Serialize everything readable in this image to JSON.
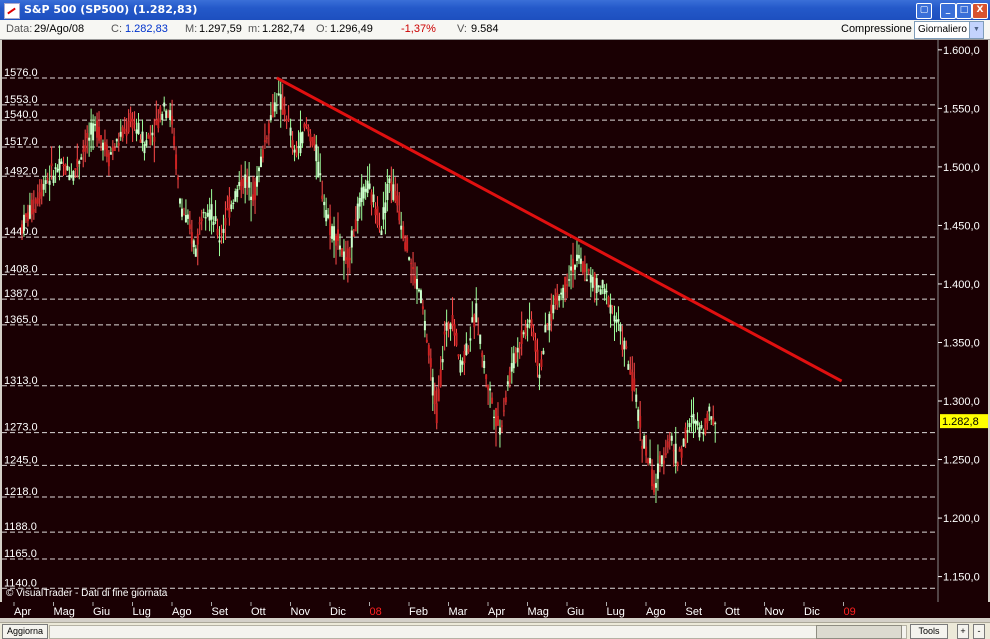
{
  "window": {
    "title": "S&P 500 (SP500) (1.282,83)",
    "min_label": "_",
    "max_label": "□",
    "close_label": "X",
    "restore_label": "▢"
  },
  "infobar": {
    "date_label": "Data:",
    "date_value": "29/Ago/08",
    "close_label": "C:",
    "close_value": "1.282,83",
    "max_label": "M:",
    "max_value": "1.297,59",
    "min_label": "m:",
    "min_value": "1.282,74",
    "open_label": "O:",
    "open_value": "1.296,49",
    "change_value": "-1,37%",
    "volume_label": "V:",
    "volume_value": "9.584",
    "compression_label": "Compressione",
    "compression_value": "Giornaliero"
  },
  "chart_data": {
    "type": "candlestick",
    "price_axis": [
      "1.600,0",
      "1.550,0",
      "1.500,0",
      "1.450,0",
      "1.400,0",
      "1.350,0",
      "1.300,0",
      "1.250,0",
      "1.200,0",
      "1.150,0"
    ],
    "ylim": [
      1130,
      1605
    ],
    "last_price_label": "1.282,8",
    "last_price": 1282.8,
    "support_levels": [
      {
        "label": "1576.0",
        "value": 1576
      },
      {
        "label": "1553.0",
        "value": 1553
      },
      {
        "label": "1540.0",
        "value": 1540
      },
      {
        "label": "1517.0",
        "value": 1517
      },
      {
        "label": "1492.0",
        "value": 1492
      },
      {
        "label": "1440.0",
        "value": 1440
      },
      {
        "label": "1408.0",
        "value": 1408
      },
      {
        "label": "1387.0",
        "value": 1387
      },
      {
        "label": "1365.0",
        "value": 1365
      },
      {
        "label": "1313.0",
        "value": 1313
      },
      {
        "label": "1273.0",
        "value": 1273
      },
      {
        "label": "1245.0",
        "value": 1245
      },
      {
        "label": "1218.0",
        "value": 1218
      },
      {
        "label": "1188.0",
        "value": 1188
      },
      {
        "label": "1165.0",
        "value": 1165
      },
      {
        "label": "1140.0",
        "value": 1140
      }
    ],
    "months": [
      {
        "label": "Apr",
        "red": false
      },
      {
        "label": "Mag",
        "red": false
      },
      {
        "label": "Giu",
        "red": false
      },
      {
        "label": "Lug",
        "red": false
      },
      {
        "label": "Ago",
        "red": false
      },
      {
        "label": "Set",
        "red": false
      },
      {
        "label": "Ott",
        "red": false
      },
      {
        "label": "Nov",
        "red": false
      },
      {
        "label": "Dic",
        "red": false
      },
      {
        "label": "08",
        "red": true
      },
      {
        "label": "Feb",
        "red": false
      },
      {
        "label": "Mar",
        "red": false
      },
      {
        "label": "Apr",
        "red": false
      },
      {
        "label": "Mag",
        "red": false
      },
      {
        "label": "Giu",
        "red": false
      },
      {
        "label": "Lug",
        "red": false
      },
      {
        "label": "Ago",
        "red": false
      },
      {
        "label": "Set",
        "red": false
      },
      {
        "label": "Ott",
        "red": false
      },
      {
        "label": "Nov",
        "red": false
      },
      {
        "label": "Dic",
        "red": false
      },
      {
        "label": "09",
        "red": true
      }
    ],
    "trendline": {
      "from": {
        "month": 6.45,
        "price": 1576
      },
      "to": {
        "month": 20.75,
        "price": 1317
      }
    },
    "price_path": [
      [
        0.0,
        1450
      ],
      [
        0.3,
        1468
      ],
      [
        0.6,
        1490
      ],
      [
        1.0,
        1500
      ],
      [
        1.3,
        1495
      ],
      [
        1.6,
        1520
      ],
      [
        1.9,
        1535
      ],
      [
        2.2,
        1510
      ],
      [
        2.5,
        1525
      ],
      [
        2.8,
        1540
      ],
      [
        3.1,
        1520
      ],
      [
        3.4,
        1535
      ],
      [
        3.6,
        1555
      ],
      [
        3.8,
        1540
      ],
      [
        4.0,
        1470
      ],
      [
        4.2,
        1450
      ],
      [
        4.4,
        1430
      ],
      [
        4.6,
        1470
      ],
      [
        4.8,
        1460
      ],
      [
        5.0,
        1440
      ],
      [
        5.3,
        1470
      ],
      [
        5.6,
        1490
      ],
      [
        5.9,
        1480
      ],
      [
        6.2,
        1530
      ],
      [
        6.45,
        1560
      ],
      [
        6.7,
        1545
      ],
      [
        6.9,
        1510
      ],
      [
        7.2,
        1535
      ],
      [
        7.4,
        1520
      ],
      [
        7.6,
        1480
      ],
      [
        7.8,
        1450
      ],
      [
        8.0,
        1440
      ],
      [
        8.2,
        1415
      ],
      [
        8.5,
        1460
      ],
      [
        8.7,
        1485
      ],
      [
        8.9,
        1470
      ],
      [
        9.1,
        1450
      ],
      [
        9.3,
        1490
      ],
      [
        9.5,
        1470
      ],
      [
        9.7,
        1440
      ],
      [
        9.9,
        1410
      ],
      [
        10.1,
        1390
      ],
      [
        10.3,
        1340
      ],
      [
        10.5,
        1290
      ],
      [
        10.7,
        1355
      ],
      [
        10.9,
        1375
      ],
      [
        11.1,
        1330
      ],
      [
        11.3,
        1350
      ],
      [
        11.5,
        1375
      ],
      [
        11.7,
        1330
      ],
      [
        11.9,
        1300
      ],
      [
        12.1,
        1275
      ],
      [
        12.3,
        1315
      ],
      [
        12.5,
        1340
      ],
      [
        12.7,
        1360
      ],
      [
        12.9,
        1370
      ],
      [
        13.1,
        1325
      ],
      [
        13.3,
        1365
      ],
      [
        13.5,
        1385
      ],
      [
        13.7,
        1395
      ],
      [
        13.9,
        1415
      ],
      [
        14.1,
        1420
      ],
      [
        14.3,
        1410
      ],
      [
        14.5,
        1400
      ],
      [
        14.7,
        1395
      ],
      [
        14.9,
        1385
      ],
      [
        15.1,
        1365
      ],
      [
        15.3,
        1340
      ],
      [
        15.5,
        1310
      ],
      [
        15.7,
        1270
      ],
      [
        15.9,
        1245
      ],
      [
        16.0,
        1225
      ],
      [
        16.2,
        1250
      ],
      [
        16.4,
        1270
      ],
      [
        16.6,
        1250
      ],
      [
        16.8,
        1270
      ],
      [
        17.0,
        1285
      ],
      [
        17.2,
        1275
      ],
      [
        17.4,
        1290
      ],
      [
        17.6,
        1282
      ]
    ]
  },
  "footer": {
    "credit": "VisualTrader - Dati di fine giornata",
    "update_button": "Aggiorna",
    "tools_button": "Tools",
    "plus_label": "+",
    "minus_label": "-"
  },
  "colors": {
    "chart_bg": "#1a0003",
    "grid": "#ffffff",
    "trendline": "#e01010",
    "candle": "#ccffcc",
    "axis_text": "#ffffff",
    "month_red": "#ff2020",
    "last_price_bg": "#ffff00"
  }
}
